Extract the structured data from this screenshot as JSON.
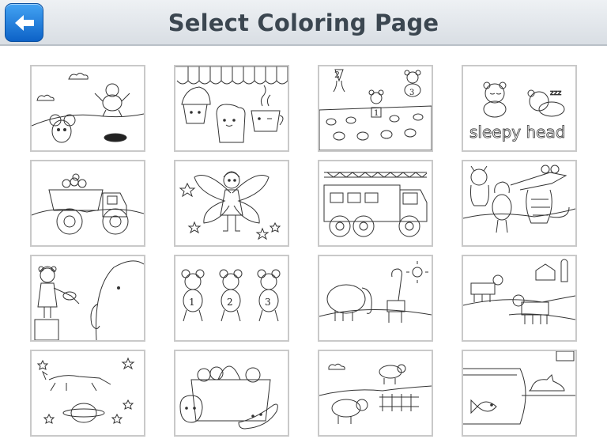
{
  "header": {
    "title": "Select Coloring Page",
    "back_icon": "back-arrow-icon",
    "accent": "#1b7fe0"
  },
  "pages": [
    {
      "name": "mice-on-hill",
      "texts": []
    },
    {
      "name": "cupcake-toast-coffee",
      "texts": []
    },
    {
      "name": "mice-board-game",
      "texts": [
        "2",
        "3",
        "1"
      ]
    },
    {
      "name": "sleepy-head-bears",
      "texts": [
        "zzz",
        "sleepy head"
      ]
    },
    {
      "name": "dump-truck",
      "texts": []
    },
    {
      "name": "fairy-girl",
      "texts": []
    },
    {
      "name": "fire-truck",
      "texts": []
    },
    {
      "name": "monsters-and-crocodile",
      "texts": []
    },
    {
      "name": "violin-girl-elephant",
      "texts": []
    },
    {
      "name": "three-mice",
      "texts": [
        "1",
        "2",
        "3"
      ]
    },
    {
      "name": "elephant-giraffe",
      "texts": []
    },
    {
      "name": "cows-barn",
      "texts": []
    },
    {
      "name": "horse-space",
      "texts": []
    },
    {
      "name": "fruit-basket",
      "texts": []
    },
    {
      "name": "sheep-field",
      "texts": []
    },
    {
      "name": "fish-bowl-cat",
      "texts": []
    }
  ]
}
